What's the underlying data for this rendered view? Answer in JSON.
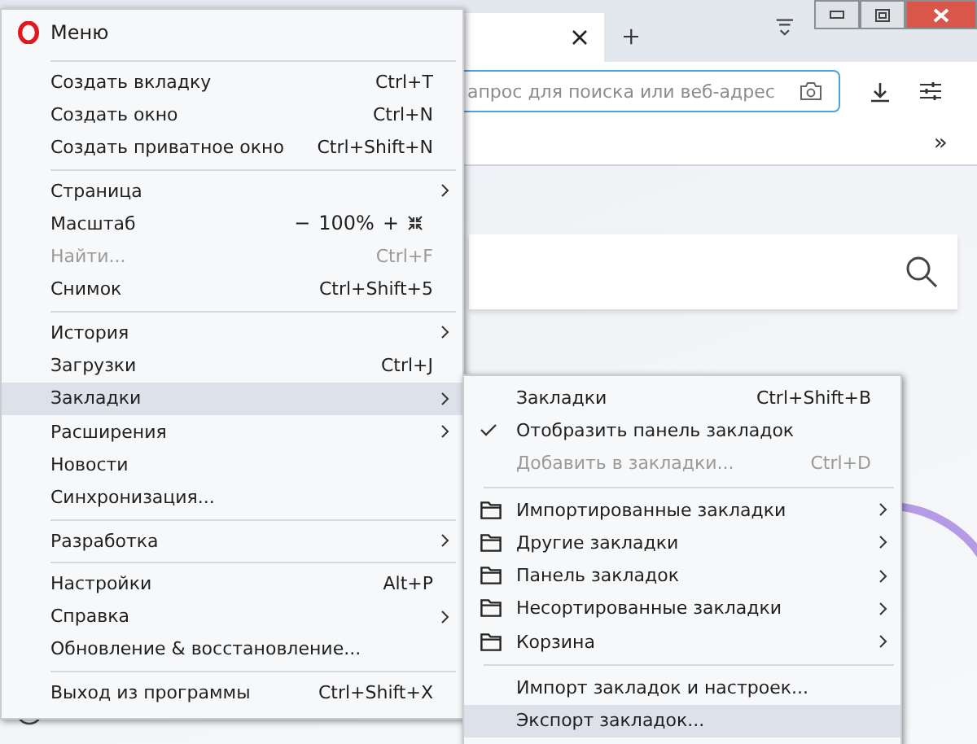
{
  "browser": {
    "address_placeholder": "апрос для поиска или веб-адрес",
    "bookmarks_overflow": "»"
  },
  "menu": {
    "title": "Меню",
    "sections": [
      [
        {
          "label": "Создать вкладку",
          "shortcut": "Ctrl+T",
          "arrow": false,
          "disabled": false,
          "selected": false
        },
        {
          "label": "Создать окно",
          "shortcut": "Ctrl+N",
          "arrow": false,
          "disabled": false,
          "selected": false
        },
        {
          "label": "Создать приватное окно",
          "shortcut": "Ctrl+Shift+N",
          "arrow": false,
          "disabled": false,
          "selected": false
        }
      ],
      [
        {
          "label": "Страница",
          "arrow": true,
          "disabled": false,
          "selected": false
        },
        {
          "label": "Масштаб",
          "kind": "zoom",
          "zoom": {
            "minus": "−",
            "value": "100%",
            "plus": "+"
          },
          "arrow": false,
          "disabled": false,
          "selected": false
        },
        {
          "label": "Найти...",
          "shortcut": "Ctrl+F",
          "arrow": false,
          "disabled": true,
          "selected": false
        },
        {
          "label": "Снимок",
          "shortcut": "Ctrl+Shift+5",
          "arrow": false,
          "disabled": false,
          "selected": false
        }
      ],
      [
        {
          "label": "История",
          "arrow": true,
          "disabled": false,
          "selected": false
        },
        {
          "label": "Загрузки",
          "shortcut": "Ctrl+J",
          "arrow": false,
          "disabled": false,
          "selected": false
        },
        {
          "label": "Закладки",
          "arrow": true,
          "disabled": false,
          "selected": true
        },
        {
          "label": "Расширения",
          "arrow": true,
          "disabled": false,
          "selected": false
        },
        {
          "label": "Новости",
          "arrow": false,
          "disabled": false,
          "selected": false
        },
        {
          "label": "Синхронизация...",
          "arrow": false,
          "disabled": false,
          "selected": false
        }
      ],
      [
        {
          "label": "Разработка",
          "arrow": true,
          "disabled": false,
          "selected": false
        }
      ],
      [
        {
          "label": "Настройки",
          "shortcut": "Alt+P",
          "arrow": false,
          "disabled": false,
          "selected": false
        },
        {
          "label": "Справка",
          "arrow": true,
          "disabled": false,
          "selected": false
        },
        {
          "label": "Обновление & восстановление...",
          "arrow": false,
          "disabled": false,
          "selected": false
        }
      ],
      [
        {
          "label": "Выход из программы",
          "shortcut": "Ctrl+Shift+X",
          "arrow": false,
          "disabled": false,
          "selected": false
        }
      ]
    ]
  },
  "submenu": {
    "sections": [
      [
        {
          "kind": "plain",
          "label": "Закладки",
          "shortcut": "Ctrl+Shift+B",
          "arrow": false,
          "disabled": false,
          "selected": false
        },
        {
          "kind": "check",
          "label": "Отобразить панель закладок",
          "checked": true,
          "arrow": false,
          "disabled": false,
          "selected": false
        },
        {
          "kind": "plain",
          "label": "Добавить в закладки...",
          "shortcut": "Ctrl+D",
          "arrow": false,
          "disabled": true,
          "selected": false
        }
      ],
      [
        {
          "kind": "folder",
          "label": "Импортированные закладки",
          "arrow": true,
          "disabled": false,
          "selected": false
        },
        {
          "kind": "folder",
          "label": "Другие закладки",
          "arrow": true,
          "disabled": false,
          "selected": false
        },
        {
          "kind": "folder",
          "label": "Панель закладок",
          "arrow": true,
          "disabled": false,
          "selected": false
        },
        {
          "kind": "folder",
          "label": "Несортированные закладки",
          "arrow": true,
          "disabled": false,
          "selected": false
        },
        {
          "kind": "folder",
          "label": "Корзина",
          "arrow": true,
          "disabled": false,
          "selected": false
        }
      ],
      [
        {
          "kind": "plain",
          "label": "Импорт закладок и настроек...",
          "arrow": false,
          "disabled": false,
          "selected": false
        },
        {
          "kind": "plain",
          "label": "Экспорт закладок...",
          "arrow": false,
          "disabled": false,
          "selected": true
        }
      ]
    ]
  }
}
